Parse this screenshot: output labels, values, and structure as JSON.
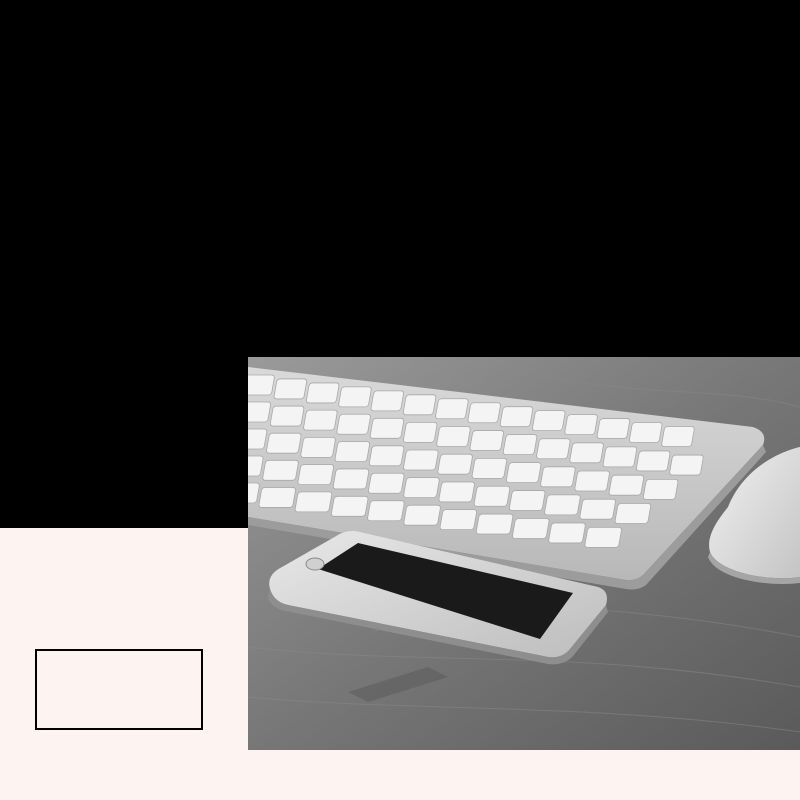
{
  "colors": {
    "top_band": "#000000",
    "bottom_band": "#fdf4f2",
    "box_border": "#000000"
  },
  "photo": {
    "style": "grayscale",
    "objects": [
      "wireless-keyboard",
      "smartphone",
      "mouse",
      "wooden-desk"
    ]
  },
  "placeholder_box": {
    "text": ""
  }
}
